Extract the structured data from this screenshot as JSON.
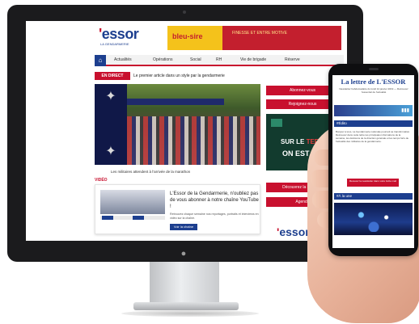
{
  "website": {
    "logo": "essor",
    "logo_apostrophe": "'",
    "logo_subtitle": "LA GENDARMERIE",
    "header_ad": {
      "title": "bleu-sire",
      "sub": "FINESSE ET ENTRE MOTIVE"
    },
    "nav": {
      "home_icon": "home-icon",
      "items": [
        "Actualités",
        "Opérations",
        "Social",
        "RH",
        "Vie de brigade",
        "Réserve"
      ]
    },
    "breaking": {
      "tag": "EN DIRECT",
      "text": "Le premier article dans un style par la gendarmerie"
    },
    "hero_caption": "Les militaires attendent à l'arrivée de la marathon",
    "sidebar": {
      "btn1": "Abonnez-vous",
      "btn2": "Rejoignez-nous",
      "btn3": "Découvrez la boutique",
      "btn4": "Agenda"
    },
    "side_ad": {
      "line1_a": "SUR LE ",
      "line1_b": "TERRAIN",
      "line2": "ON EST TE"
    },
    "section_title": "VIDÉO",
    "youtube": {
      "heading": "L'Essor de la Gendarmerie, n'oubliez pas de vous abonner à notre chaîne YouTube !",
      "body": "Retrouvez chaque semaine nos reportages, portraits et interviews en vidéo sur la chaîne.",
      "button": "Voir la chaîne"
    },
    "bottom_logo": "essor"
  },
  "phone": {
    "title": "La lettre de L'ESSOR",
    "subtitle": "Newsletter hebdomadaire du lundi 14 janvier 2019 — Retrouvez l'essentiel de l'actualité",
    "section_editorial": "#Édito",
    "editorial_text": "Bonjour à tous, La Gendarmerie nationale poursuit sa transformation. Retrouvez dans cette lettre les principales informations de la semaine, les décisions de la direction générale et les temps forts de l'actualité des militaires de la gendarmerie.",
    "button": "Recevez la newsletter dans votre boîte mail",
    "section_news": "#À la une"
  },
  "icons": {
    "hero_side": "insignia-icon",
    "stand_logo": "apple-logo-icon",
    "signal": "signal-icon"
  },
  "colors": {
    "brand_blue": "#1d3f8f",
    "brand_red": "#c8102e",
    "monitor": "#1b1b1d"
  }
}
